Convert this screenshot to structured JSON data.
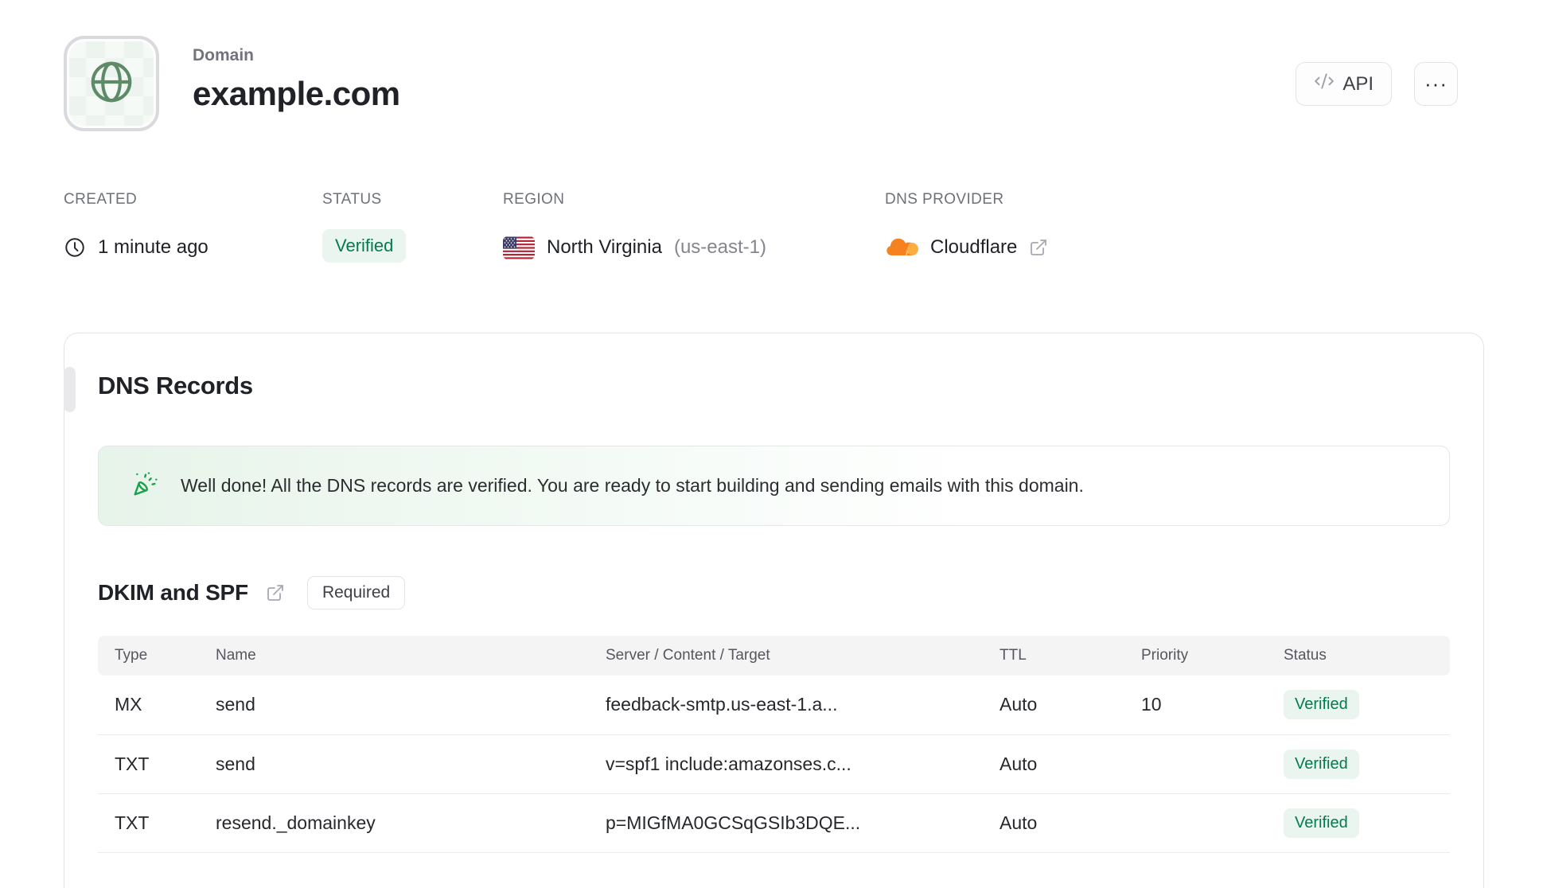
{
  "header": {
    "label": "Domain",
    "title": "example.com",
    "api_button_label": "API",
    "more_button_label": "···"
  },
  "meta": {
    "created": {
      "label": "CREATED",
      "value": "1 minute ago"
    },
    "status": {
      "label": "STATUS",
      "value": "Verified"
    },
    "region": {
      "label": "REGION",
      "value": "North Virginia",
      "code": "(us-east-1)"
    },
    "dns_provider": {
      "label": "DNS PROVIDER",
      "value": "Cloudflare"
    }
  },
  "dns_records": {
    "title": "DNS Records",
    "banner_message": "Well done! All the DNS records are verified. You are ready to start building and sending emails with this domain.",
    "section_title": "DKIM and SPF",
    "section_badge": "Required",
    "table": {
      "columns": [
        "Type",
        "Name",
        "Server / Content / Target",
        "TTL",
        "Priority",
        "Status"
      ],
      "rows": [
        {
          "type": "MX",
          "name": "send",
          "content": "feedback-smtp.us-east-1.a...",
          "ttl": "Auto",
          "priority": "10",
          "status": "Verified"
        },
        {
          "type": "TXT",
          "name": "send",
          "content": "v=spf1 include:amazonses.c...",
          "ttl": "Auto",
          "priority": "",
          "status": "Verified"
        },
        {
          "type": "TXT",
          "name": "resend._domainkey",
          "content": "p=MIGfMA0GCSqGSIb3DQE...",
          "ttl": "Auto",
          "priority": "",
          "status": "Verified"
        }
      ]
    }
  },
  "colors": {
    "verified_text": "#047a52",
    "verified_bg": "#e9f5ee",
    "cloudflare_orange": "#f6821f",
    "globe_green": "#5d8a67",
    "banner_green": "#e7f4ea",
    "border": "#e4e4e7"
  }
}
